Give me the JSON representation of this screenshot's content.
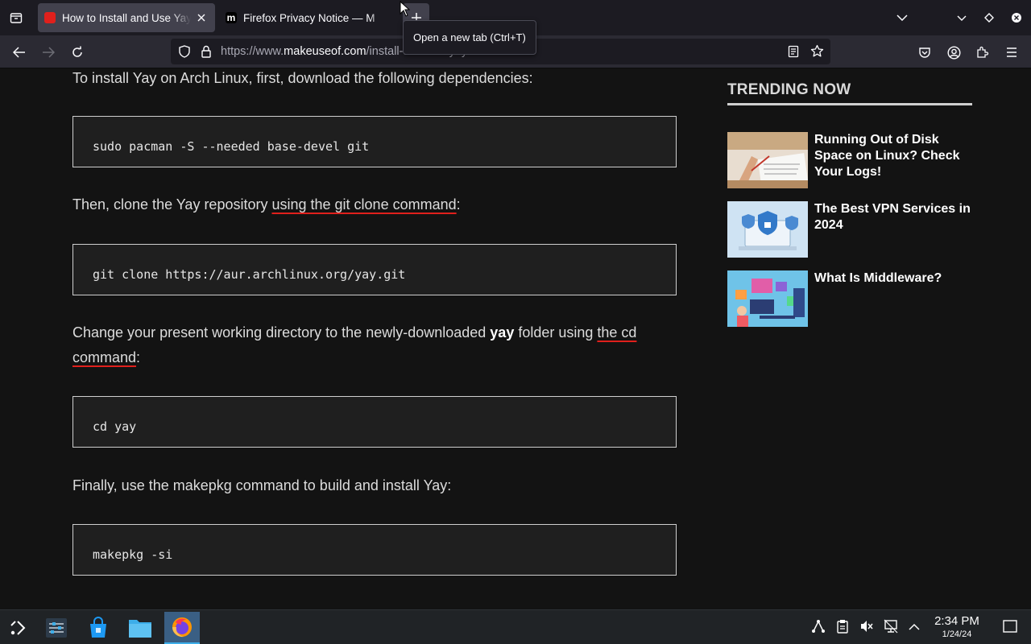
{
  "browser": {
    "tabs": [
      {
        "title": "How to Install and Use Yay",
        "favicon_color": "#e0201c"
      },
      {
        "title": "Firefox Privacy Notice — M",
        "favicon_color": "#000000"
      }
    ],
    "tooltip": "Open a new tab (Ctrl+T)",
    "url": {
      "prefix": "https://www.",
      "host": "makeuseof.com",
      "path": "/install-and-use-yay-arch-linux/"
    }
  },
  "article": {
    "p1": "To install Yay on Arch Linux, first, download the following dependencies:",
    "code1": "sudo pacman -S --needed base-devel git",
    "p2_before": "Then, clone the Yay repository ",
    "p2_link": "using the git clone command",
    "p2_after": ":",
    "code2": "git clone https://aur.archlinux.org/yay.git",
    "p3_before": "Change your present working directory to the newly-downloaded ",
    "p3_bold": "yay",
    "p3_middle": " folder using ",
    "p3_link": "the cd command",
    "p3_after": ":",
    "code3": "cd yay",
    "p4": "Finally, use the makepkg command to build and install Yay:",
    "code4": "makepkg -si"
  },
  "sidebar": {
    "heading": "TRENDING NOW",
    "items": [
      {
        "title": "Running Out of Disk Space on Linux? Check Your Logs!"
      },
      {
        "title": "The Best VPN Services in 2024"
      },
      {
        "title": "What Is Middleware?"
      }
    ]
  },
  "taskbar": {
    "time": "2:34 PM",
    "date": "1/24/24"
  },
  "colors": {
    "accent_link_underline": "#e0201c",
    "taskbar_active": "#3a5f84"
  }
}
